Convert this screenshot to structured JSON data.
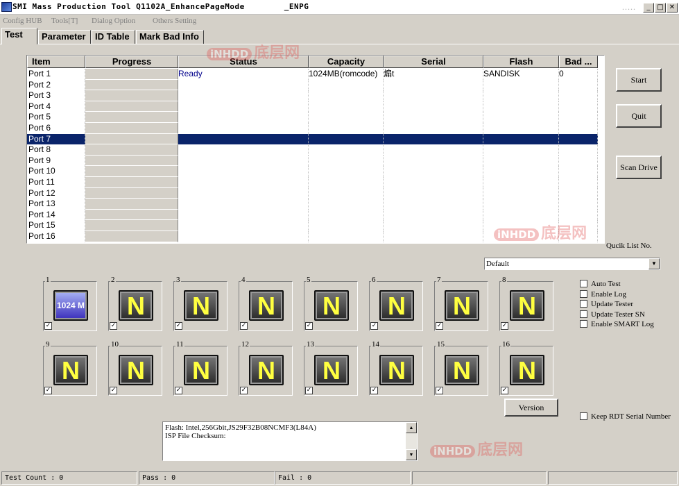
{
  "window": {
    "title": "SMI Mass Production Tool Q1102A_EnhancePageMode        _ENPG",
    "min_glyph": "_",
    "max_glyph": "□",
    "close_glyph": "✕"
  },
  "menu": [
    "Config HUB",
    "Tools[T]",
    "Dialog Option",
    "Others Setting"
  ],
  "tabs": [
    "Test",
    "Parameter",
    "ID Table",
    "Mark Bad Info"
  ],
  "grid": {
    "columns": [
      "Item",
      "Progress",
      "Status",
      "Capacity",
      "Serial",
      "Flash",
      "Bad ..."
    ],
    "rows": [
      {
        "item": "Port 1",
        "status": "Ready",
        "capacity": "1024MB(romcode)",
        "serial": "煽t",
        "flash": "SANDISK",
        "bad": "0"
      },
      {
        "item": "Port 2"
      },
      {
        "item": "Port 3"
      },
      {
        "item": "Port 4"
      },
      {
        "item": "Port 5"
      },
      {
        "item": "Port 6"
      },
      {
        "item": "Port 7",
        "selected": true
      },
      {
        "item": "Port 8"
      },
      {
        "item": "Port 9"
      },
      {
        "item": "Port 10"
      },
      {
        "item": "Port 11"
      },
      {
        "item": "Port 12"
      },
      {
        "item": "Port 13"
      },
      {
        "item": "Port 14"
      },
      {
        "item": "Port 15"
      },
      {
        "item": "Port 16"
      }
    ]
  },
  "buttons": {
    "start": "Start",
    "quit": "Quit",
    "scan": "Scan Drive",
    "version": "Version"
  },
  "quick_list": {
    "label": "Qucik List No.",
    "value": "Default"
  },
  "ports": [
    {
      "num": "1",
      "icon": "drive-ready",
      "label": "1024 M"
    },
    {
      "num": "2",
      "icon": "N"
    },
    {
      "num": "3",
      "icon": "N"
    },
    {
      "num": "4",
      "icon": "N"
    },
    {
      "num": "5",
      "icon": "N"
    },
    {
      "num": "6",
      "icon": "N"
    },
    {
      "num": "7",
      "icon": "N"
    },
    {
      "num": "8",
      "icon": "N"
    },
    {
      "num": "9",
      "icon": "N"
    },
    {
      "num": "10",
      "icon": "N"
    },
    {
      "num": "11",
      "icon": "N"
    },
    {
      "num": "12",
      "icon": "N"
    },
    {
      "num": "13",
      "icon": "N"
    },
    {
      "num": "14",
      "icon": "N"
    },
    {
      "num": "15",
      "icon": "N"
    },
    {
      "num": "16",
      "icon": "N"
    }
  ],
  "options": [
    "Auto Test",
    "Enable Log",
    "Update Tester",
    "Update Tester SN",
    "Enable SMART Log"
  ],
  "keep_rdt": "Keep RDT Serial Number",
  "log": [
    "Flash: Intel,256Gbit,JS29F32B08NCMF3(L84A)",
    "ISP File Checksum:"
  ],
  "statusbar": {
    "test_count": "Test Count : 0",
    "pass": "Pass : 0",
    "fail": "Fail : 0"
  },
  "watermark": {
    "badge": "iNHDD",
    "text": "底层网"
  },
  "colors": {
    "selection": "#0a246a",
    "status_text": "#00008b",
    "face": "#d4d0c8"
  }
}
